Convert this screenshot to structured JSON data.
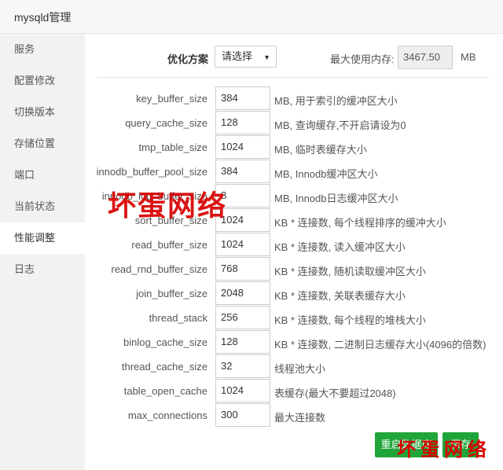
{
  "window": {
    "title": "mysqld管理"
  },
  "sidebar": {
    "items": [
      {
        "label": "服务"
      },
      {
        "label": "配置修改"
      },
      {
        "label": "切换版本"
      },
      {
        "label": "存储位置"
      },
      {
        "label": "端口"
      },
      {
        "label": "当前状态"
      },
      {
        "label": "性能调整",
        "active": true
      },
      {
        "label": "日志"
      }
    ]
  },
  "optimize": {
    "label": "优化方案",
    "selected": "请选择",
    "max_mem_label": "最大使用内存:",
    "max_mem_value": "3467.50",
    "max_mem_unit": "MB"
  },
  "params": [
    {
      "name": "key_buffer_size",
      "value": "384",
      "desc": "MB, 用于索引的缓冲区大小"
    },
    {
      "name": "query_cache_size",
      "value": "128",
      "desc": "MB, 查询缓存,不开启请设为0"
    },
    {
      "name": "tmp_table_size",
      "value": "1024",
      "desc": "MB, 临时表缓存大小"
    },
    {
      "name": "innodb_buffer_pool_size",
      "value": "384",
      "desc": "MB, Innodb缓冲区大小"
    },
    {
      "name": "innodb_log_buffer_size",
      "value": "8",
      "desc": "MB, Innodb日志缓冲区大小"
    },
    {
      "name": "sort_buffer_size",
      "value": "1024",
      "desc": "KB * 连接数, 每个线程排序的缓冲大小"
    },
    {
      "name": "read_buffer_size",
      "value": "1024",
      "desc": "KB * 连接数, 读入缓冲区大小"
    },
    {
      "name": "read_rnd_buffer_size",
      "value": "768",
      "desc": "KB * 连接数, 随机读取缓冲区大小"
    },
    {
      "name": "join_buffer_size",
      "value": "2048",
      "desc": "KB * 连接数, 关联表缓存大小"
    },
    {
      "name": "thread_stack",
      "value": "256",
      "desc": "KB * 连接数, 每个线程的堆栈大小"
    },
    {
      "name": "binlog_cache_size",
      "value": "128",
      "desc": "KB * 连接数, 二进制日志缓存大小(4096的倍数)"
    },
    {
      "name": "thread_cache_size",
      "value": "32",
      "desc": "线程池大小"
    },
    {
      "name": "table_open_cache",
      "value": "1024",
      "desc": "表缓存(最大不要超过2048)"
    },
    {
      "name": "max_connections",
      "value": "300",
      "desc": "最大连接数"
    }
  ],
  "buttons": {
    "restart": "重启数据库",
    "save": "保存"
  },
  "watermark": {
    "text": "坏蛋网络"
  },
  "colors": {
    "accent": "#20a53a",
    "watermark": "#d90000"
  }
}
